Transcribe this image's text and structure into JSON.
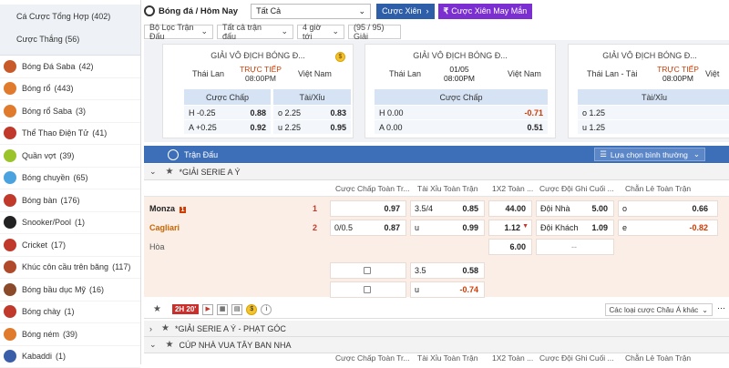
{
  "sidebar": {
    "top_items": [
      "Cá Cược Tổng Hợp (402)",
      "Cược Thắng (56)"
    ],
    "items": [
      {
        "label": "Bóng Đá Saba",
        "count": "(42)",
        "color": "#c85a2a"
      },
      {
        "label": "Bóng rổ",
        "count": "(443)",
        "color": "#e07b2e"
      },
      {
        "label": "Bóng rổ Saba",
        "count": "(3)",
        "color": "#e07b2e"
      },
      {
        "label": "Thể Thao Điện Tử",
        "count": "(41)",
        "color": "#c0392b"
      },
      {
        "label": "Quần vợt",
        "count": "(39)",
        "color": "#9bc42a"
      },
      {
        "label": "Bóng chuyền",
        "count": "(65)",
        "color": "#4aa3df"
      },
      {
        "label": "Bóng bàn",
        "count": "(176)",
        "color": "#c0392b"
      },
      {
        "label": "Snooker/Pool",
        "count": "(1)",
        "color": "#222222"
      },
      {
        "label": "Cricket",
        "count": "(17)",
        "color": "#c0392b"
      },
      {
        "label": "Khúc côn cầu trên băng",
        "count": "(117)",
        "color": "#b04a2a"
      },
      {
        "label": "Bóng bầu dục Mỹ",
        "count": "(16)",
        "color": "#8b4a2a"
      },
      {
        "label": "Bóng chày",
        "count": "(1)",
        "color": "#c0392b"
      },
      {
        "label": "Bóng ném",
        "count": "(39)",
        "color": "#e07b2e"
      },
      {
        "label": "Kabaddi",
        "count": "(1)",
        "color": "#3a5fa8"
      }
    ]
  },
  "toolbar": {
    "sport": "Bóng đá / Hôm Nay",
    "filter_select": "Tất Cả",
    "parlay_btn": "Cược Xiên",
    "lucky_btn": "Cược Xiên May Mắn",
    "filters": [
      "Bộ Lọc Trận Đấu",
      "Tất cả trận đấu",
      "4 giờ tới",
      "(95 / 95) Giải"
    ]
  },
  "cards": [
    {
      "title": "GIẢI VÔ ĐỊCH BÓNG Đ...",
      "home": "Thái Lan",
      "away": "Việt Nam",
      "status": "TRỰC TIẾP",
      "time": "08:00PM",
      "col1": "Cược Chấp",
      "col2": "Tài/Xỉu",
      "rows": [
        [
          "H -0.25",
          "0.88",
          "o 2.25",
          "0.83"
        ],
        [
          "A +0.25",
          "0.92",
          "u 2.25",
          "0.95"
        ]
      ]
    },
    {
      "title": "GIẢI VÔ ĐỊCH BÓNG Đ...",
      "home": "Thái Lan",
      "away": "Việt Nam",
      "status": "01/05",
      "time": "08:00PM",
      "col1": "Cược Chấp",
      "rows": [
        [
          "H 0.00",
          "-0.71"
        ],
        [
          "A 0.00",
          "0.51"
        ]
      ]
    },
    {
      "title": "GIẢI VÔ ĐỊCH BÓNG Đ...",
      "home": "Thái Lan - Tài",
      "away": "Việt",
      "status": "TRỰC TIẾP",
      "time": "08:00PM",
      "col1": "Tài/Xỉu",
      "rows": [
        [
          "o 1.25"
        ],
        [
          "u 1.25"
        ]
      ]
    }
  ],
  "match_bar": {
    "title": "Trận Đấu",
    "view_select": "Lựa chọn bình thường"
  },
  "league1": "*GIẢI SERIE A Ý",
  "odds_headers": [
    "Cược Chấp Toàn Tr...",
    "Tài Xỉu Toàn Trận",
    "1X2 Toàn ...",
    "Cược Đội Ghi Cuối ...",
    "Chẵn Lẻ Toàn Trận"
  ],
  "match": {
    "home": "Monza",
    "home_red": "1",
    "home_score": "1",
    "away": "Cagliari",
    "away_score": "2",
    "draw": "Hòa",
    "hdp": {
      "line": "0/0.5",
      "home": "0.97",
      "away": "0.87"
    },
    "ou": {
      "line_o": "3.5/4",
      "o": "0.85",
      "line_u": "u",
      "u": "0.99"
    },
    "x12": {
      "h": "44.00",
      "a": "1.12",
      "d": "6.00",
      "a_arrow": "▼"
    },
    "last_goal": {
      "home_label": "Đội Nhà",
      "home": "5.00",
      "away_label": "Đội Khách",
      "away": "1.09",
      "none": "--"
    },
    "oe": {
      "o_label": "o",
      "o": "0.66",
      "e_label": "e",
      "e": "-0.82"
    },
    "extra_ou": {
      "line": "3.5",
      "o": "0.58",
      "u_label": "u",
      "u": "-0.74"
    }
  },
  "action_row": {
    "live": "2H 20'",
    "bet_type": "Các loại cược Châu Á khác"
  },
  "league2": "*GIẢI SERIE A Ý - PHẠT GÓC",
  "league3": "CÚP NHÀ VUA TÂY BAN NHA",
  "footer_headers": [
    "Cược Chấp Toàn Tr...",
    "Tài Xỉu Toàn Trận",
    "1X2 Toàn ...",
    "Cược Đội Ghi Cuối ...",
    "Chẵn Lẻ Toàn Trận"
  ]
}
